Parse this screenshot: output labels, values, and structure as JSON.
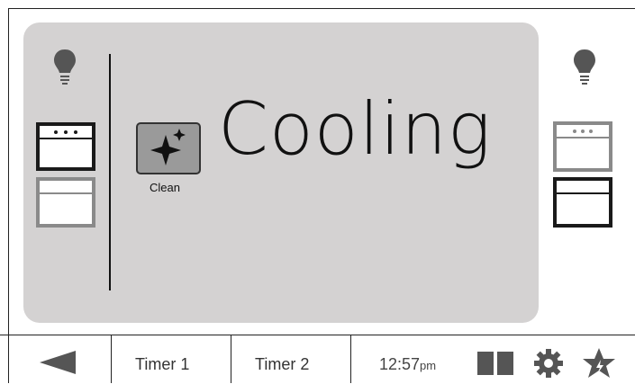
{
  "status": {
    "text": "Cooling",
    "mode_label": "Clean"
  },
  "left_oven": {
    "light_icon": "lightbulb-icon",
    "upper_oven": "oven-upper-icon",
    "lower_oven": "oven-lower-icon",
    "selected": "upper"
  },
  "right_oven": {
    "light_icon": "lightbulb-icon",
    "upper_oven": "oven-upper-icon",
    "lower_oven": "oven-lower-icon",
    "selected": "lower"
  },
  "bottom_bar": {
    "back_icon": "back-arrow-icon",
    "timer1_label": "Timer 1",
    "timer2_label": "Timer 2",
    "time": "12:57",
    "ampm": "pm",
    "view_icon": "split-view-icon",
    "settings_icon": "gear-icon",
    "favorites_icon": "star-icon"
  },
  "colors": {
    "panel": "#d4d2d2",
    "selected_oven": "#1a1a1a",
    "unselected_oven": "#8a8a8a",
    "icon_gray": "#555555"
  }
}
